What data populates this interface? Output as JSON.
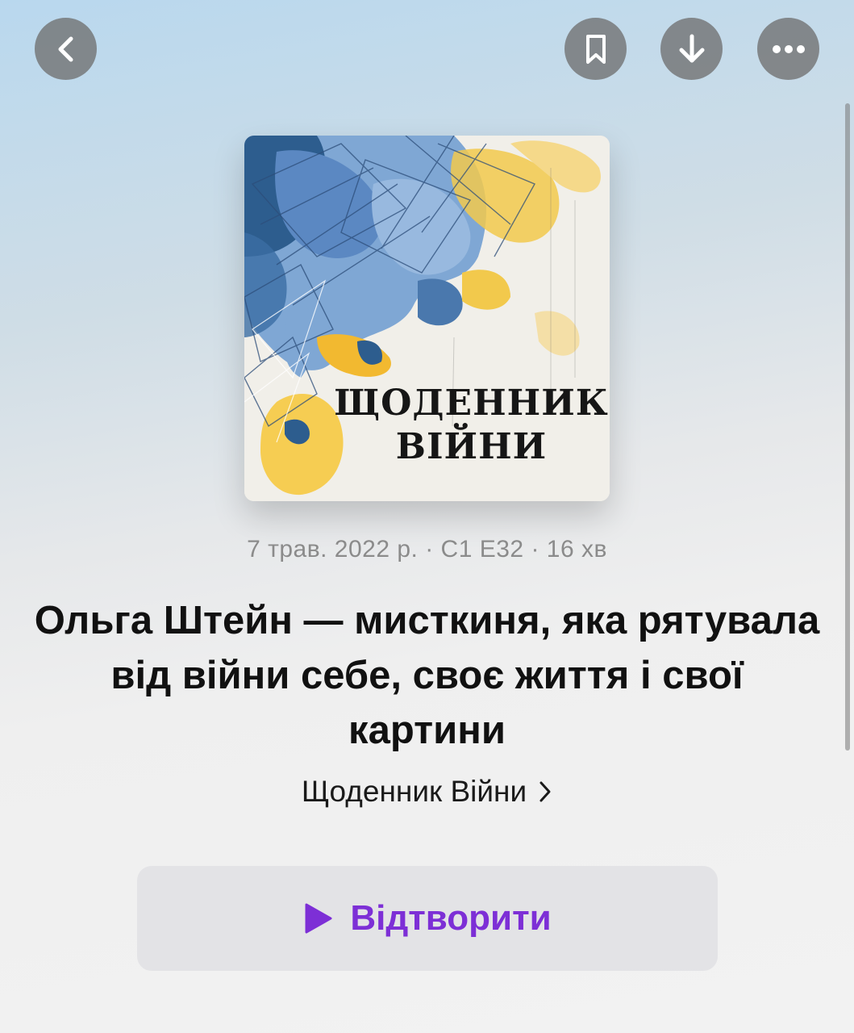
{
  "nav": {
    "back_icon": "chevron-left-icon",
    "bookmark_icon": "bookmark-icon",
    "download_icon": "arrow-down-icon",
    "more_icon": "ellipsis-icon"
  },
  "artwork": {
    "title_line1": "ЩОДЕННИК",
    "title_line2": "ВІЙНИ"
  },
  "episode": {
    "meta": "7 трав. 2022 р. · С1 Е32 · 16 хв",
    "title": "Ольга Штейн — мисткиня, яка рятувала від війни себе, своє життя і свої картини",
    "show_name": "Щоденник Війни"
  },
  "play": {
    "label": "Відтворити",
    "accent_color": "#7d2fd6"
  }
}
